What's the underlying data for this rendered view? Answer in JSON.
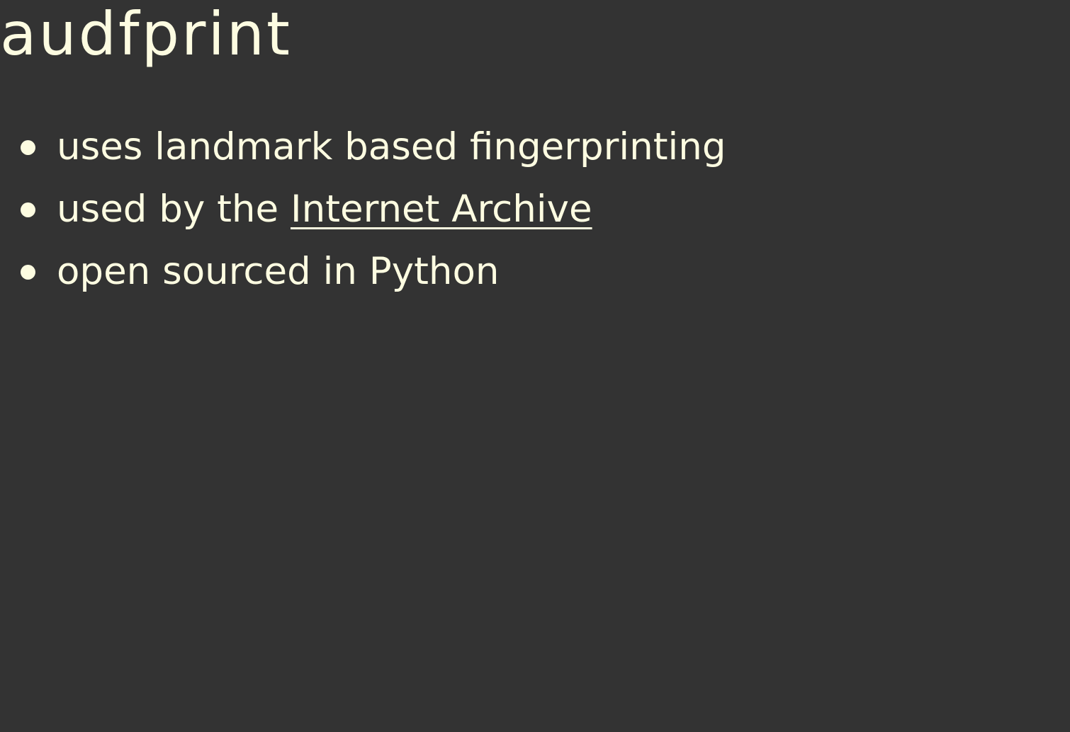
{
  "slide": {
    "title": "audfprint",
    "bullets": [
      {
        "text": "uses landmark based fingerprinting"
      },
      {
        "text": "used by the ",
        "link_text": "Internet Archive"
      },
      {
        "text": "open sourced in Python"
      }
    ]
  },
  "colors": {
    "background": "#333333",
    "text": "#fdfce1"
  }
}
